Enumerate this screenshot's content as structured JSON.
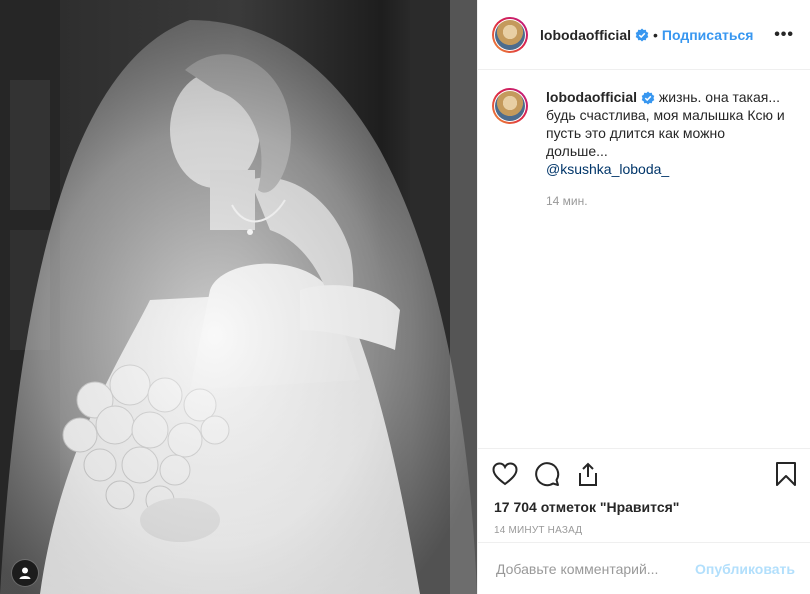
{
  "header": {
    "username": "lobodaofficial",
    "separator": "•",
    "follow_label": "Подписаться",
    "more_label": "•••"
  },
  "caption": {
    "username": "lobodaofficial",
    "text": "жизнь. она такая... будь счастлива, моя малышка Ксю и пусть это длится как можно дольше...",
    "mention": "@ksushka_loboda_",
    "time": "14 мин."
  },
  "actions": {
    "icons": [
      "heart-icon",
      "comment-icon",
      "share-icon",
      "bookmark-icon"
    ]
  },
  "likes": {
    "label": "17 704 отметок \"Нравится\""
  },
  "posted": {
    "label": "14 минут назад"
  },
  "comment": {
    "placeholder": "Добавьте комментарий...",
    "publish_label": "Опубликовать"
  },
  "colors": {
    "link": "#3897f0",
    "mention": "#003569",
    "muted": "#999999",
    "publish_disabled": "#b2dffc"
  }
}
